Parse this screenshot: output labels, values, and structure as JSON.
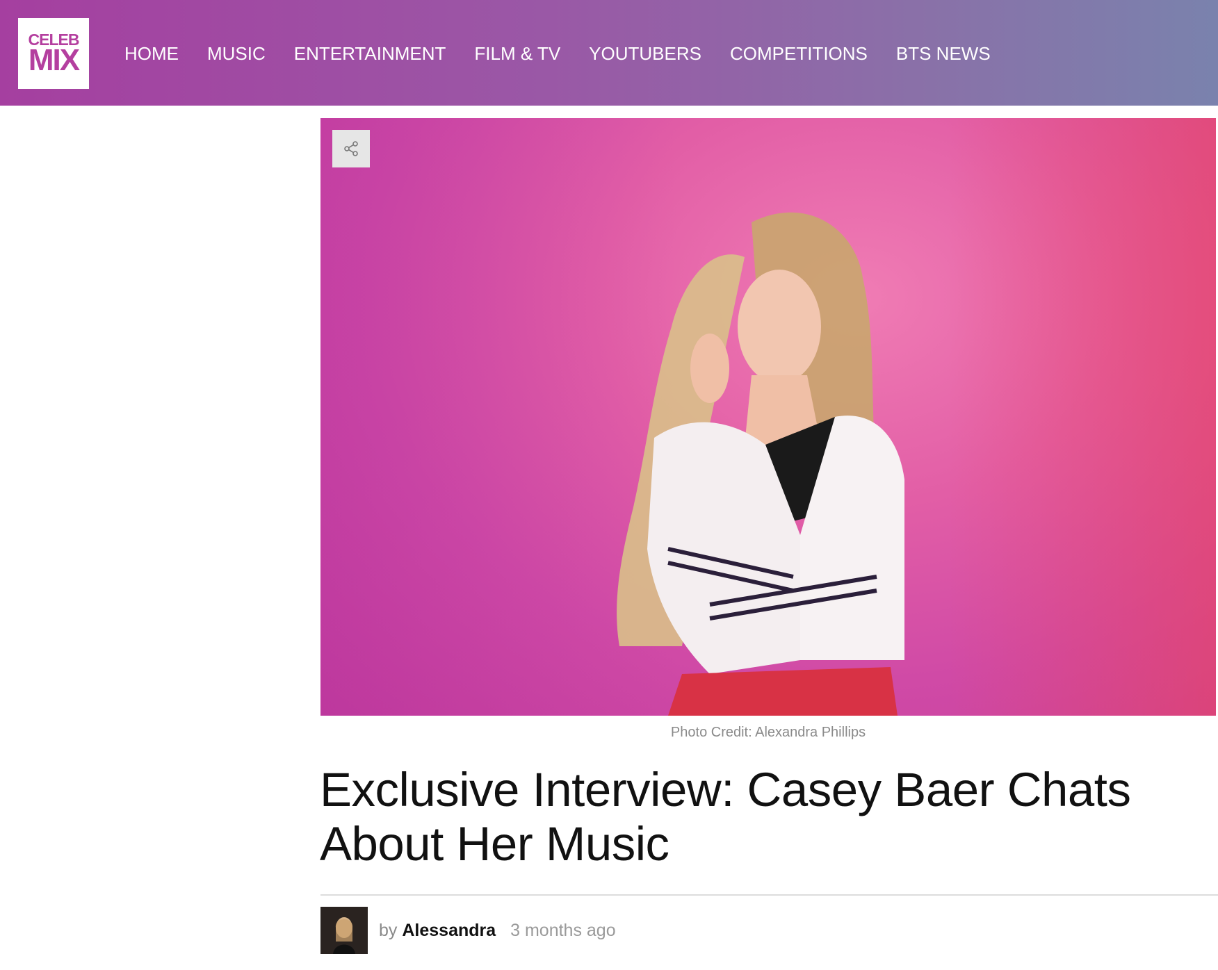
{
  "brand": {
    "logo_top": "CELEB",
    "logo_bottom": "MIX",
    "accent": "#b43f9f"
  },
  "nav": {
    "items": [
      {
        "label": "HOME"
      },
      {
        "label": "MUSIC"
      },
      {
        "label": "ENTERTAINMENT"
      },
      {
        "label": "FILM & TV"
      },
      {
        "label": "YOUTUBERS"
      },
      {
        "label": "COMPETITIONS"
      },
      {
        "label": "BTS NEWS"
      }
    ]
  },
  "hero": {
    "share_icon": "share-icon",
    "caption": "Photo Credit: Alexandra Phillips"
  },
  "article": {
    "title": "Exclusive Interview: Casey Baer Chats About Her Music",
    "by_label": "by",
    "author": "Alessandra",
    "time_ago": "3 months ago"
  }
}
